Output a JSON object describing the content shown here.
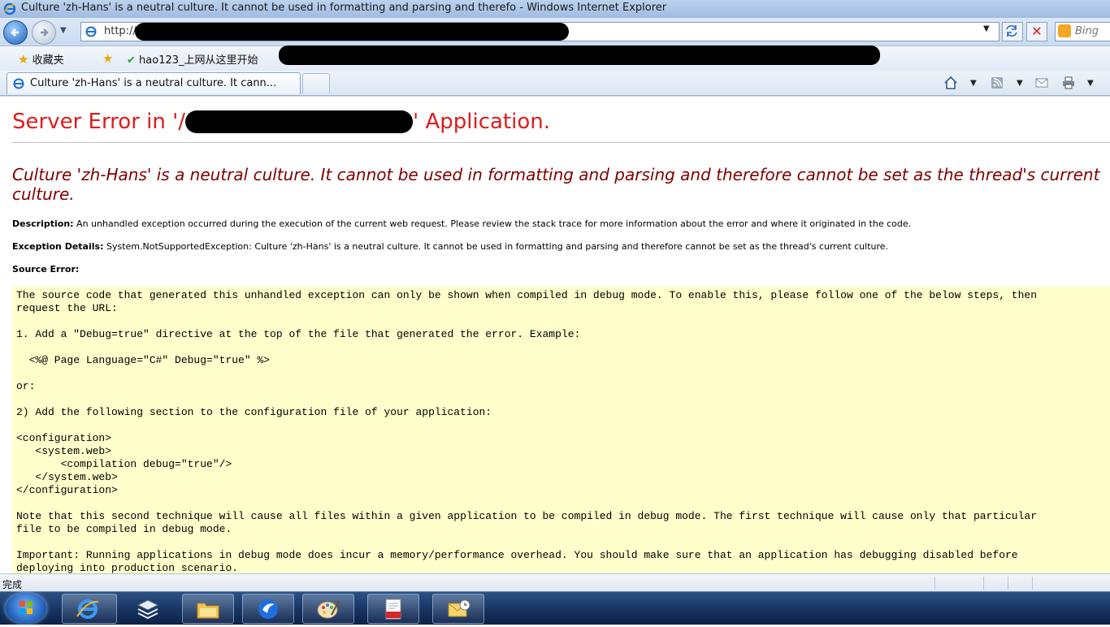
{
  "window": {
    "title": "Culture 'zh-Hans' is a neutral culture. It cannot be used in formatting and parsing and therefo - Windows Internet Explorer"
  },
  "address_bar": {
    "url_prefix": "http://"
  },
  "search": {
    "engine": "Bing"
  },
  "favorites_bar": {
    "favorites_label": "收藏夹",
    "site_label": "hao123_上网从这里开始"
  },
  "tabs": [
    {
      "label": "Culture 'zh-Hans' is a neutral culture. It cann..."
    }
  ],
  "page": {
    "heading_prefix": "Server Error in '/",
    "heading_suffix": "' Application.",
    "error_message": "Culture 'zh-Hans' is a neutral culture. It cannot be used in formatting and parsing and therefore cannot be set as the thread's current culture.",
    "description_label": "Description:",
    "description_text": " An unhandled exception occurred during the execution of the current web request. Please review the stack trace for more information about the error and where it originated in the code.",
    "exception_label": "Exception Details:",
    "exception_text": " System.NotSupportedException: Culture 'zh-Hans' is a neutral culture. It cannot be used in formatting and parsing and therefore cannot be set as the thread's current culture.",
    "source_error_label": "Source Error:",
    "source_text": "The source code that generated this unhandled exception can only be shown when compiled in debug mode. To enable this, please follow one of the below steps, then\nrequest the URL:\n\n1. Add a \"Debug=true\" directive at the top of the file that generated the error. Example:\n\n  <%@ Page Language=\"C#\" Debug=\"true\" %>\n\nor:\n\n2) Add the following section to the configuration file of your application:\n\n<configuration>\n   <system.web>\n       <compilation debug=\"true\"/>\n   </system.web>\n</configuration>\n\nNote that this second technique will cause all files within a given application to be compiled in debug mode. The first technique will cause only that particular\nfile to be compiled in debug mode.\n\nImportant: Running applications in debug mode does incur a memory/performance overhead. You should make sure that an application has debugging disabled before\ndeploying into production scenario."
  },
  "statusbar": {
    "status": "完成"
  },
  "taskbar": {
    "items": [
      "internet-explorer",
      "layers-app",
      "file-explorer",
      "browser-app",
      "paint-app",
      "pdf-reader",
      "mail-app"
    ],
    "active": "internet-explorer"
  },
  "colors": {
    "heading": "#e01b1b",
    "error_message": "#800000",
    "source_box": "#ffffcc"
  }
}
